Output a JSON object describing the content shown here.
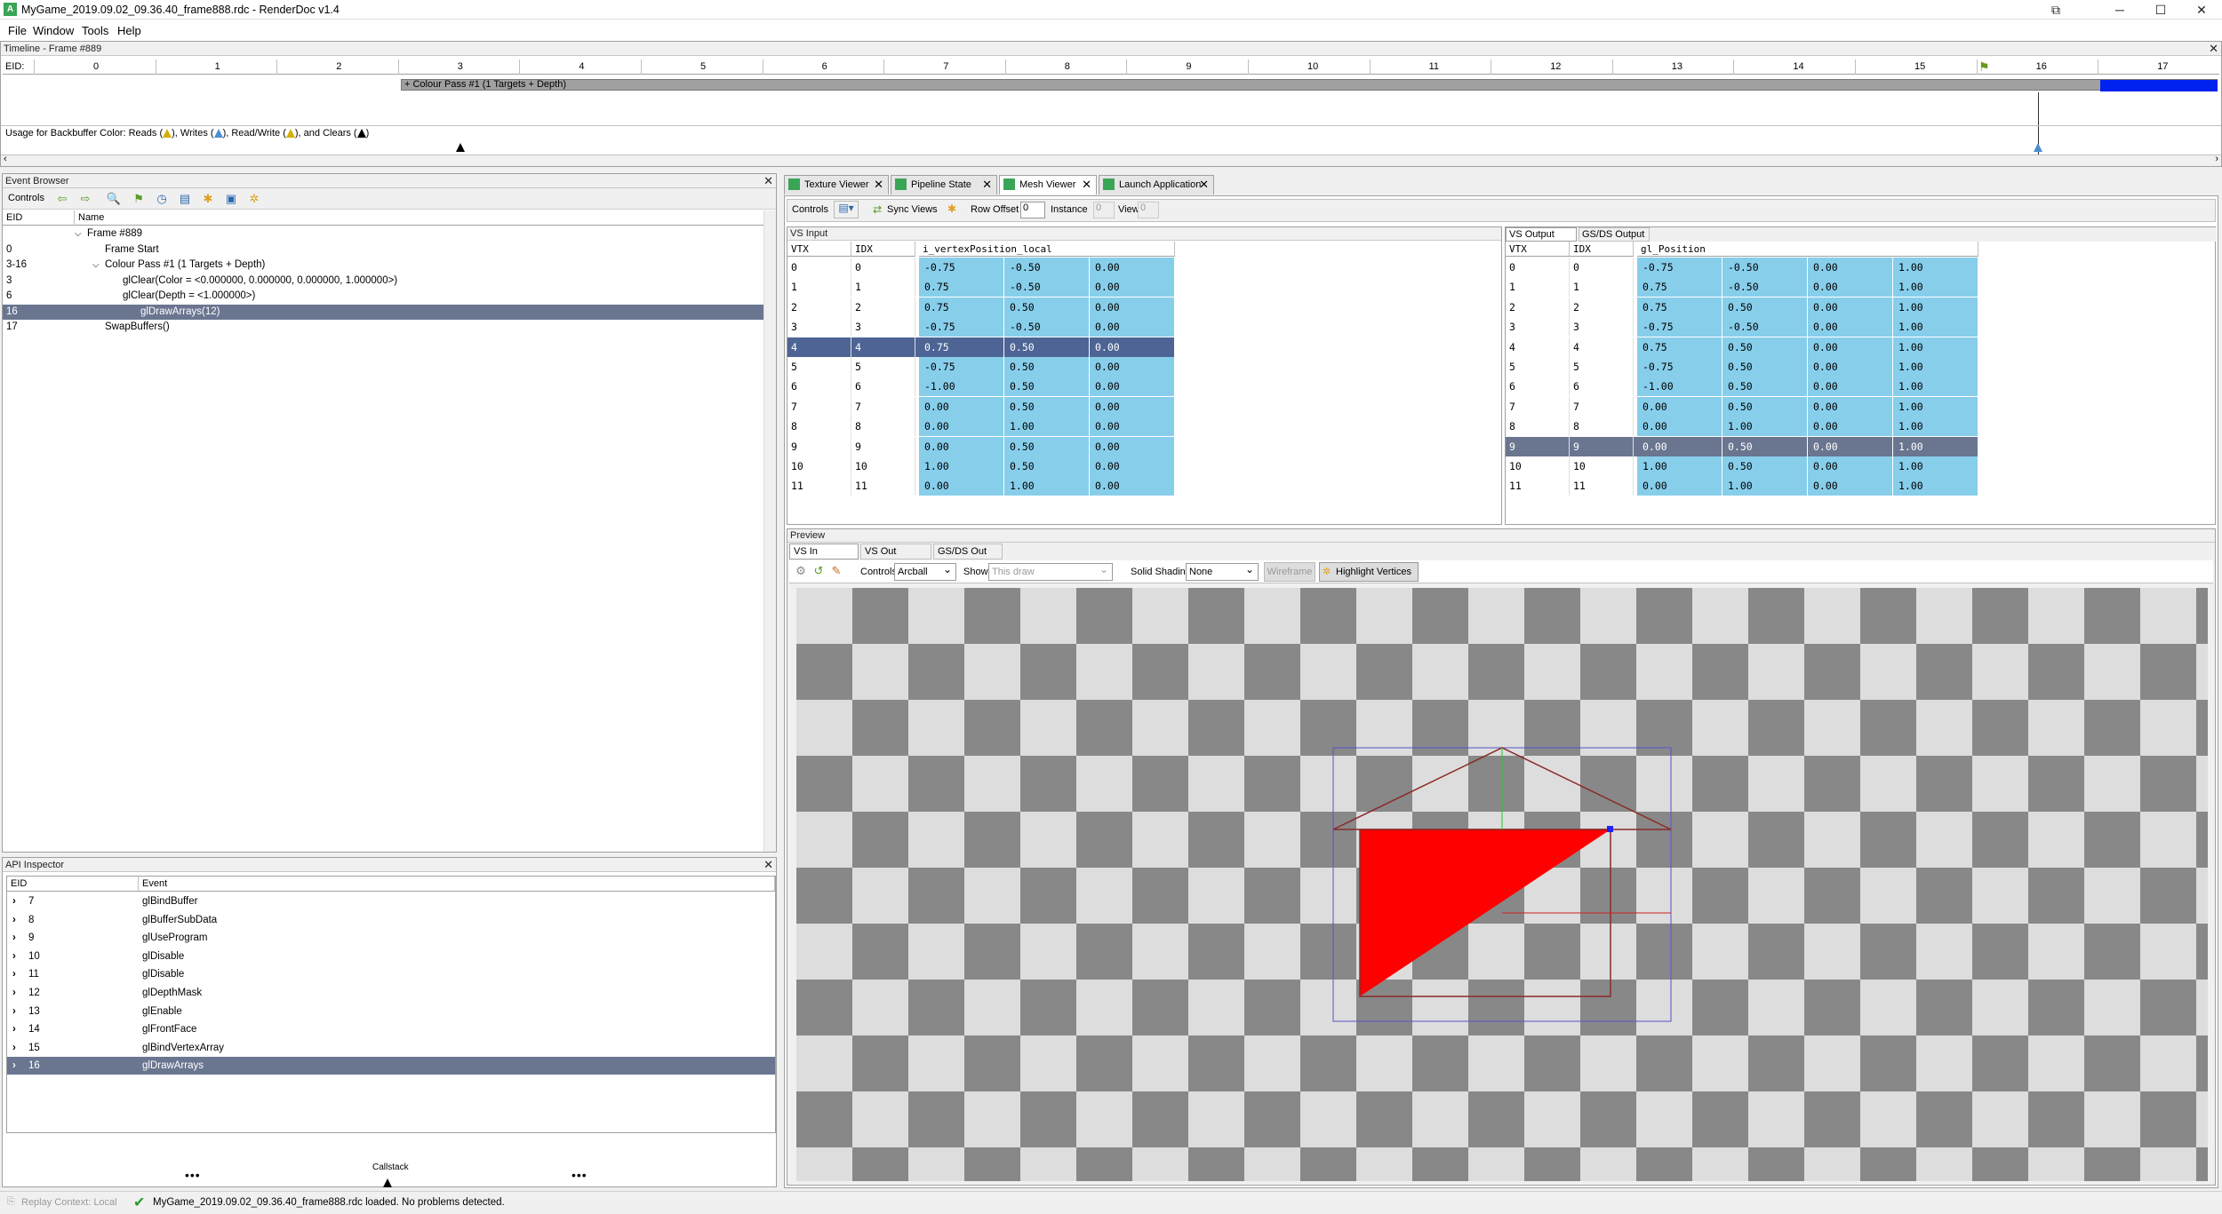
{
  "window": {
    "title": "MyGame_2019.09.02_09.36.40_frame888.rdc - RenderDoc v1.4",
    "icon": "renderdoc-icon",
    "controls": [
      "⧉",
      "─",
      "☐",
      "✕"
    ]
  },
  "menu": [
    "File",
    "Window",
    "Tools",
    "Help"
  ],
  "timeline": {
    "title": "Timeline - Frame #889",
    "eid_label": "EID:",
    "ticks": [
      "0",
      "1",
      "2",
      "3",
      "4",
      "5",
      "6",
      "7",
      "8",
      "9",
      "10",
      "11",
      "12",
      "13",
      "14",
      "15",
      "16",
      "17"
    ],
    "pass_label": "+ Colour Pass #1 (1 Targets + Depth)",
    "usage_prefix": "Usage for Backbuffer Color: Reads (",
    "usage_writes": "), Writes (",
    "usage_rw": "), Read/Write (",
    "usage_clears": "), and Clears (",
    "usage_suffix": ")"
  },
  "event_browser": {
    "title": "Event Browser",
    "controls_label": "Controls",
    "columns": [
      "EID",
      "Name"
    ],
    "rows": [
      {
        "eid": "",
        "name": "Frame #889",
        "indent": 0,
        "expand": "v"
      },
      {
        "eid": "0",
        "name": "Frame Start",
        "indent": 1,
        "expand": ""
      },
      {
        "eid": "3-16",
        "name": "Colour Pass #1 (1 Targets + Depth)",
        "indent": 1,
        "expand": "v"
      },
      {
        "eid": "3",
        "name": "glClear(Color = <0.000000, 0.000000, 0.000000, 1.000000>)",
        "indent": 2,
        "expand": ""
      },
      {
        "eid": "6",
        "name": "glClear(Depth = <1.000000>)",
        "indent": 2,
        "expand": ""
      },
      {
        "eid": "16",
        "name": "glDrawArrays(12)",
        "indent": 3,
        "expand": "",
        "selected": true
      },
      {
        "eid": "17",
        "name": "SwapBuffers()",
        "indent": 1,
        "expand": ""
      }
    ]
  },
  "api_inspector": {
    "title": "API Inspector",
    "columns": [
      "EID",
      "Event"
    ],
    "rows": [
      {
        "eid": "7",
        "event": "glBindBuffer"
      },
      {
        "eid": "8",
        "event": "glBufferSubData"
      },
      {
        "eid": "9",
        "event": "glUseProgram"
      },
      {
        "eid": "10",
        "event": "glDisable"
      },
      {
        "eid": "11",
        "event": "glDisable"
      },
      {
        "eid": "12",
        "event": "glDepthMask"
      },
      {
        "eid": "13",
        "event": "glEnable"
      },
      {
        "eid": "14",
        "event": "glFrontFace"
      },
      {
        "eid": "15",
        "event": "glBindVertexArray"
      },
      {
        "eid": "16",
        "event": "glDrawArrays",
        "selected": true
      }
    ],
    "callstack_label": "Callstack",
    "dots": "•••"
  },
  "tabs": [
    {
      "label": "Texture Viewer"
    },
    {
      "label": "Pipeline State"
    },
    {
      "label": "Mesh Viewer",
      "active": true
    },
    {
      "label": "Launch Application"
    }
  ],
  "mesh_toolbar": {
    "controls": "Controls",
    "sync": "Sync Views",
    "row_offset": "Row Offset",
    "row_offset_val": "0",
    "instance": "Instance",
    "instance_val": "0",
    "view": "View",
    "view_val": "0"
  },
  "vs_input": {
    "title": "VS Input",
    "columns": [
      "VTX",
      "IDX",
      "i_vertexPosition_local"
    ],
    "rows": [
      [
        "0",
        "0",
        "-0.75",
        "-0.50",
        "0.00"
      ],
      [
        "1",
        "1",
        "0.75",
        "-0.50",
        "0.00"
      ],
      [
        "2",
        "2",
        "0.75",
        "0.50",
        "0.00"
      ],
      [
        "3",
        "3",
        "-0.75",
        "-0.50",
        "0.00"
      ],
      [
        "4",
        "4",
        "0.75",
        "0.50",
        "0.00"
      ],
      [
        "5",
        "5",
        "-0.75",
        "0.50",
        "0.00"
      ],
      [
        "6",
        "6",
        "-1.00",
        "0.50",
        "0.00"
      ],
      [
        "7",
        "7",
        "0.00",
        "0.50",
        "0.00"
      ],
      [
        "8",
        "8",
        "0.00",
        "1.00",
        "0.00"
      ],
      [
        "9",
        "9",
        "0.00",
        "0.50",
        "0.00"
      ],
      [
        "10",
        "10",
        "1.00",
        "0.50",
        "0.00"
      ],
      [
        "11",
        "11",
        "0.00",
        "1.00",
        "0.00"
      ]
    ],
    "selected_row": 4
  },
  "vs_output": {
    "tabs": [
      "VS Output",
      "GS/DS Output"
    ],
    "columns": [
      "VTX",
      "IDX",
      "gl_Position"
    ],
    "rows": [
      [
        "0",
        "0",
        "-0.75",
        "-0.50",
        "0.00",
        "1.00"
      ],
      [
        "1",
        "1",
        "0.75",
        "-0.50",
        "0.00",
        "1.00"
      ],
      [
        "2",
        "2",
        "0.75",
        "0.50",
        "0.00",
        "1.00"
      ],
      [
        "3",
        "3",
        "-0.75",
        "-0.50",
        "0.00",
        "1.00"
      ],
      [
        "4",
        "4",
        "0.75",
        "0.50",
        "0.00",
        "1.00"
      ],
      [
        "5",
        "5",
        "-0.75",
        "0.50",
        "0.00",
        "1.00"
      ],
      [
        "6",
        "6",
        "-1.00",
        "0.50",
        "0.00",
        "1.00"
      ],
      [
        "7",
        "7",
        "0.00",
        "0.50",
        "0.00",
        "1.00"
      ],
      [
        "8",
        "8",
        "0.00",
        "1.00",
        "0.00",
        "1.00"
      ],
      [
        "9",
        "9",
        "0.00",
        "0.50",
        "0.00",
        "1.00"
      ],
      [
        "10",
        "10",
        "1.00",
        "0.50",
        "0.00",
        "1.00"
      ],
      [
        "11",
        "11",
        "0.00",
        "1.00",
        "0.00",
        "1.00"
      ]
    ],
    "selected_row": 9
  },
  "preview": {
    "title": "Preview",
    "tabs": [
      "VS In",
      "VS Out",
      "GS/DS Out"
    ],
    "controls_label": "Controls",
    "controls_value": "Arcball",
    "show_label": "Show",
    "show_value": "This draw",
    "shading_label": "Solid Shading",
    "shading_value": "None",
    "wireframe": "Wireframe",
    "highlight": "Highlight Vertices"
  },
  "status": {
    "context": "Replay Context: Local",
    "message": "MyGame_2019.09.02_09.36.40_frame888.rdc loaded. No problems detected."
  },
  "colors": {
    "accent_green": "#3aa557",
    "selection": "#6a7590",
    "cell_blue": "#87ceeb",
    "triangle": "#ff0000",
    "checker_dark": "#888888",
    "checker_light": "#dddddd",
    "timeline_blue": "#0022ee"
  }
}
